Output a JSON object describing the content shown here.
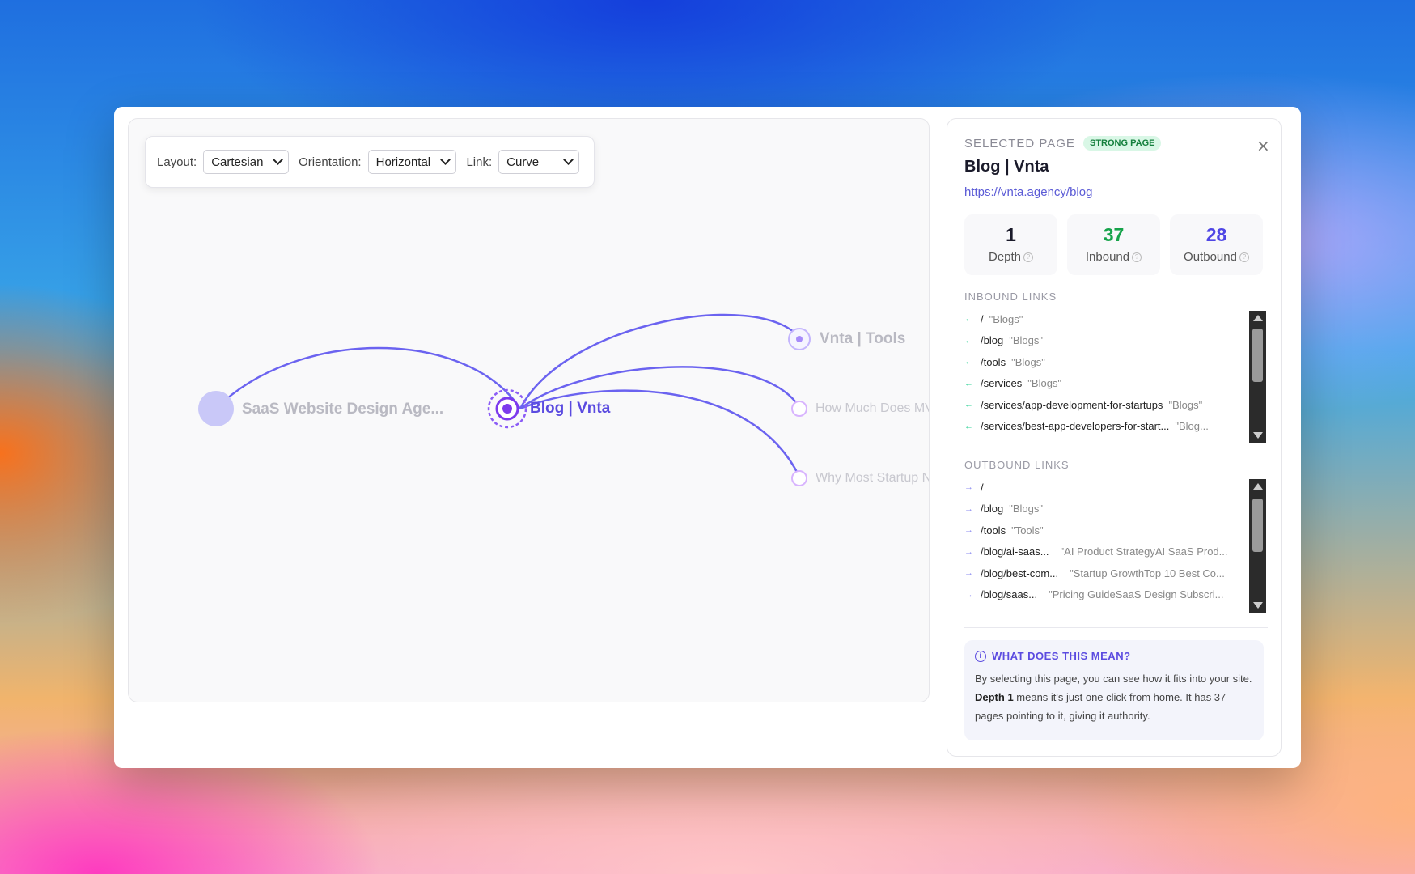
{
  "toolbar": {
    "layout_label": "Layout:",
    "layout_value": "Cartesian",
    "orientation_label": "Orientation:",
    "orientation_value": "Horizontal",
    "link_label": "Link:",
    "link_value": "Curve"
  },
  "graph": {
    "root_label": "SaaS Website Design Age...",
    "selected_label": "Blog | Vnta",
    "children": [
      "Vnta | Tools",
      "How Much Does MV",
      "Why Most Startup N"
    ],
    "accent": "#6b63f0"
  },
  "panel": {
    "heading": "SELECTED PAGE",
    "badge": "STRONG PAGE",
    "close": "×",
    "title": "Blog | Vnta",
    "url": "https://vnta.agency/blog",
    "stats": [
      {
        "value": "1",
        "label": "Depth",
        "color": "#1a1a2a"
      },
      {
        "value": "37",
        "label": "Inbound",
        "color": "#16a34a"
      },
      {
        "value": "28",
        "label": "Outbound",
        "color": "#4f46e5"
      }
    ],
    "inbound_title": "INBOUND LINKS",
    "inbound": [
      {
        "arrow": "←",
        "path": "/",
        "anchor": "\"Blogs\""
      },
      {
        "arrow": "←",
        "path": "/blog",
        "anchor": "\"Blogs\""
      },
      {
        "arrow": "←",
        "path": "/tools",
        "anchor": "\"Blogs\""
      },
      {
        "arrow": "←",
        "path": "/services",
        "anchor": "\"Blogs\""
      },
      {
        "arrow": "←",
        "path": "/services/app-development-for-startups",
        "anchor": "\"Blogs\""
      },
      {
        "arrow": "←",
        "path": "/services/best-app-developers-for-start...",
        "anchor": "\"Blog..."
      }
    ],
    "outbound_title": "OUTBOUND LINKS",
    "outbound": [
      {
        "arrow": "→",
        "path": "/",
        "anchor": ""
      },
      {
        "arrow": "→",
        "path": "/blog",
        "anchor": "\"Blogs\""
      },
      {
        "arrow": "→",
        "path": "/tools",
        "anchor": "\"Tools\""
      },
      {
        "arrow": "→",
        "path": "/blog/ai-saas...",
        "anchor": "\"AI Product StrategyAI SaaS Prod..."
      },
      {
        "arrow": "→",
        "path": "/blog/best-com...",
        "anchor": "\"Startup GrowthTop 10 Best Co..."
      },
      {
        "arrow": "→",
        "path": "/blog/saas...",
        "anchor": "\"Pricing GuideSaaS Design Subscri..."
      }
    ],
    "explain_title": "WHAT DOES THIS MEAN?",
    "explain_info_icon": "i",
    "explain_pre": "By selecting this page, you can see how it fits into your site. ",
    "explain_bold": "Depth 1",
    "explain_post": " means it's just one click from home. It has 37 pages pointing to it, giving it authority."
  }
}
